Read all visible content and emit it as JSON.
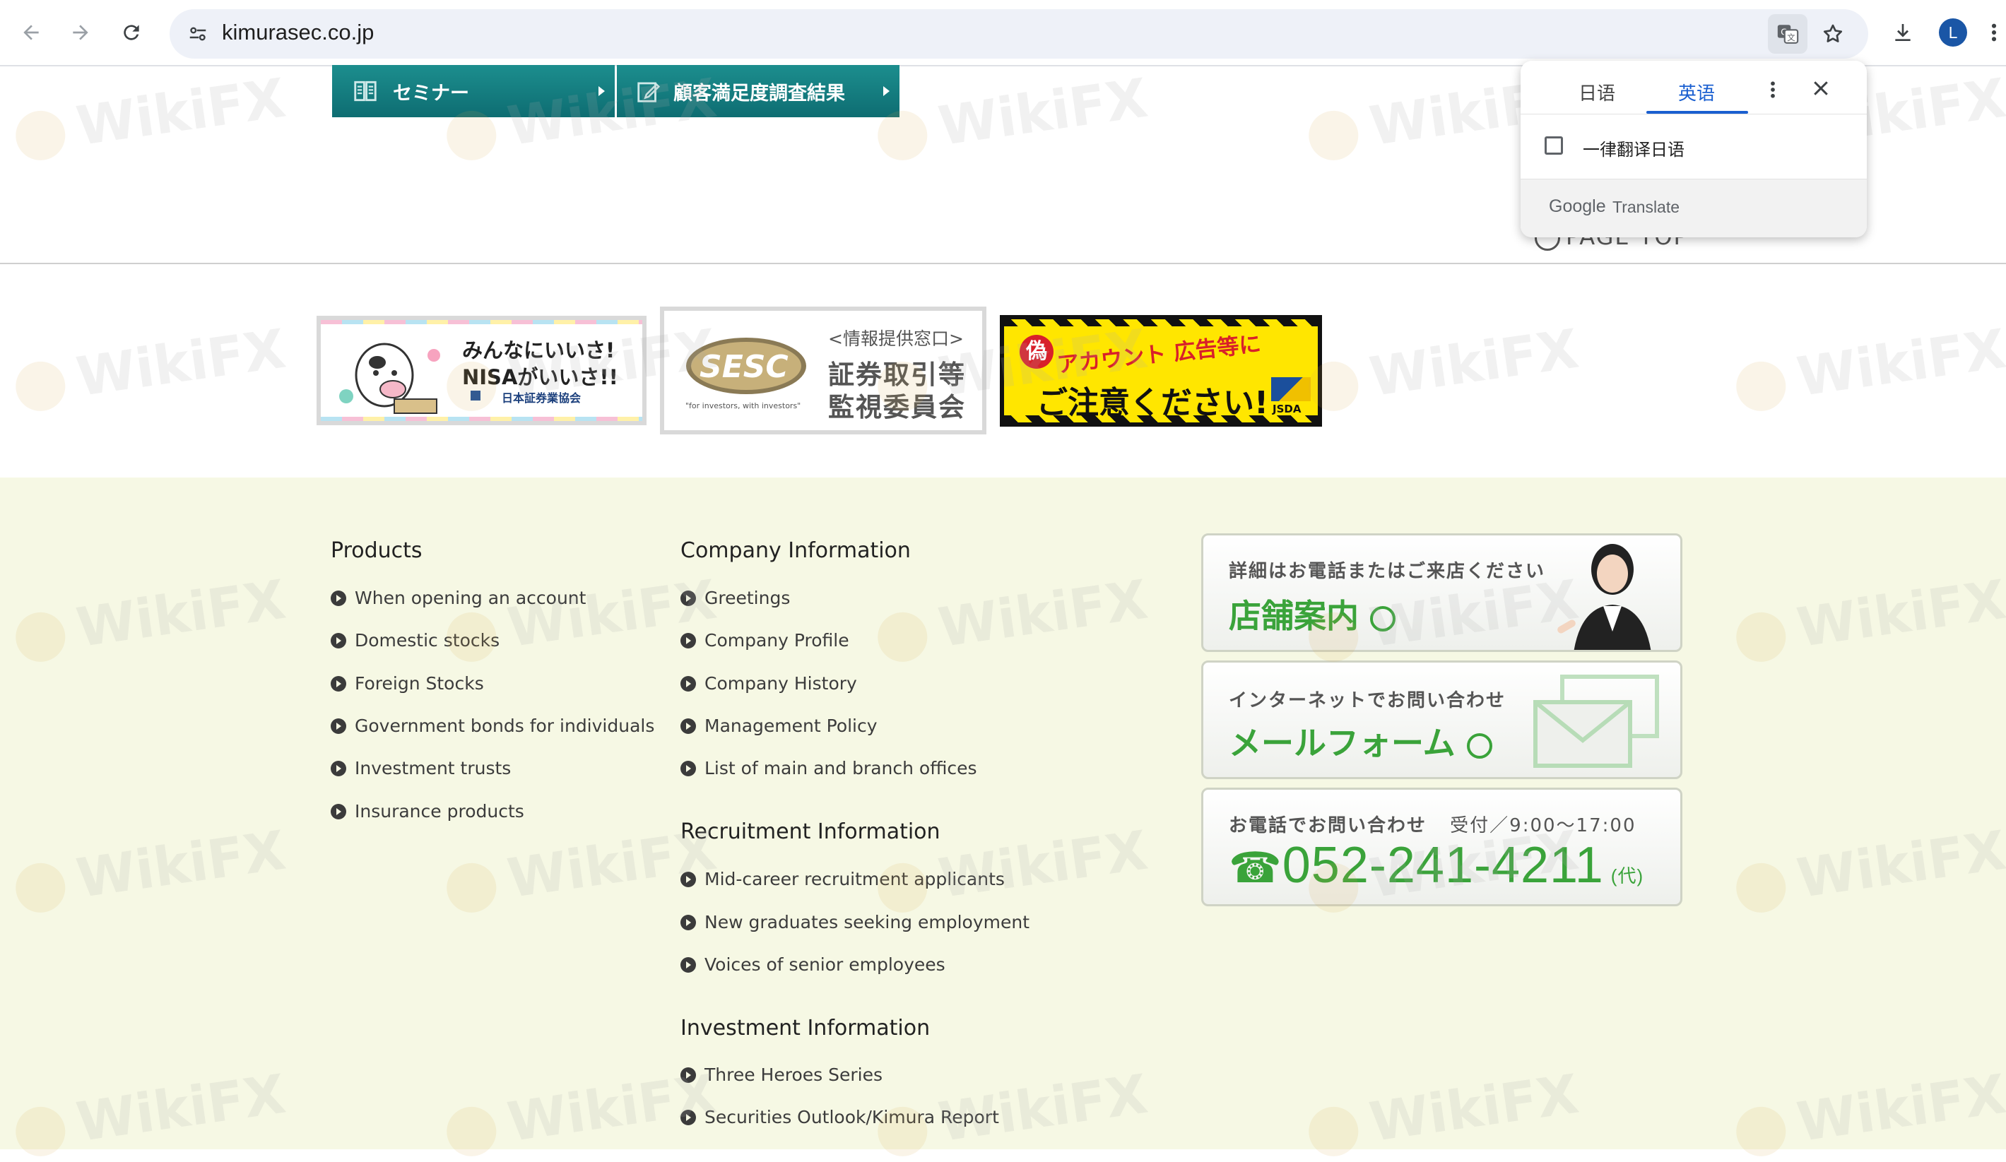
{
  "browser": {
    "url": "kimurasec.co.jp",
    "profile_initial": "L"
  },
  "nav": {
    "seminar": "セミナー",
    "survey": "顧客満足度調査結果"
  },
  "page_top": "PAGE TOP",
  "banners": {
    "nisa": {
      "line1": "みんなにいいさ!",
      "line2": "NISAがいいさ!!",
      "org": "日本証券業協会"
    },
    "sesc": {
      "logo": "SESC",
      "tagline": "\"for investors, with investors\"",
      "window": "<情報提供窓口>",
      "line1": "証券取引等",
      "line2": "監視委員会"
    },
    "jsda": {
      "top": "アカウント 広告等に",
      "fake": "偽",
      "bottom": "ご注意ください!",
      "badge": "JSDA"
    }
  },
  "footer": {
    "products": {
      "heading": "Products",
      "items": [
        "When opening an account",
        "Domestic stocks",
        "Foreign Stocks",
        "Government bonds for individuals",
        "Investment trusts",
        "Insurance products"
      ]
    },
    "company": {
      "heading": "Company Information",
      "items": [
        "Greetings",
        "Company Profile",
        "Company History",
        "Management Policy",
        "List of main and branch offices"
      ]
    },
    "recruit": {
      "heading": "Recruitment Information",
      "items": [
        "Mid-career recruitment applicants",
        "New graduates seeking employment",
        "Voices of senior employees"
      ]
    },
    "investment": {
      "heading": "Investment Information",
      "items": [
        "Three Heroes Series",
        "Securities Outlook/Kimura Report"
      ]
    },
    "contact": {
      "store_sub": "詳細はお電話またはご来店ください",
      "store_main": "店舗案内",
      "mail_sub": "インターネットでお問い合わせ",
      "mail_main": "メールフォーム",
      "phone_sub": "お電話でお問い合わせ",
      "phone_hours": "受付／9:00〜17:00",
      "phone_number": "052-241-4211",
      "phone_suffix": "(代)"
    }
  },
  "translate": {
    "tab_source": "日语",
    "tab_target": "英语",
    "always_translate": "一律翻译日语",
    "brand_google": "Google",
    "brand_translate": "Translate"
  },
  "watermark": "WikiFX"
}
